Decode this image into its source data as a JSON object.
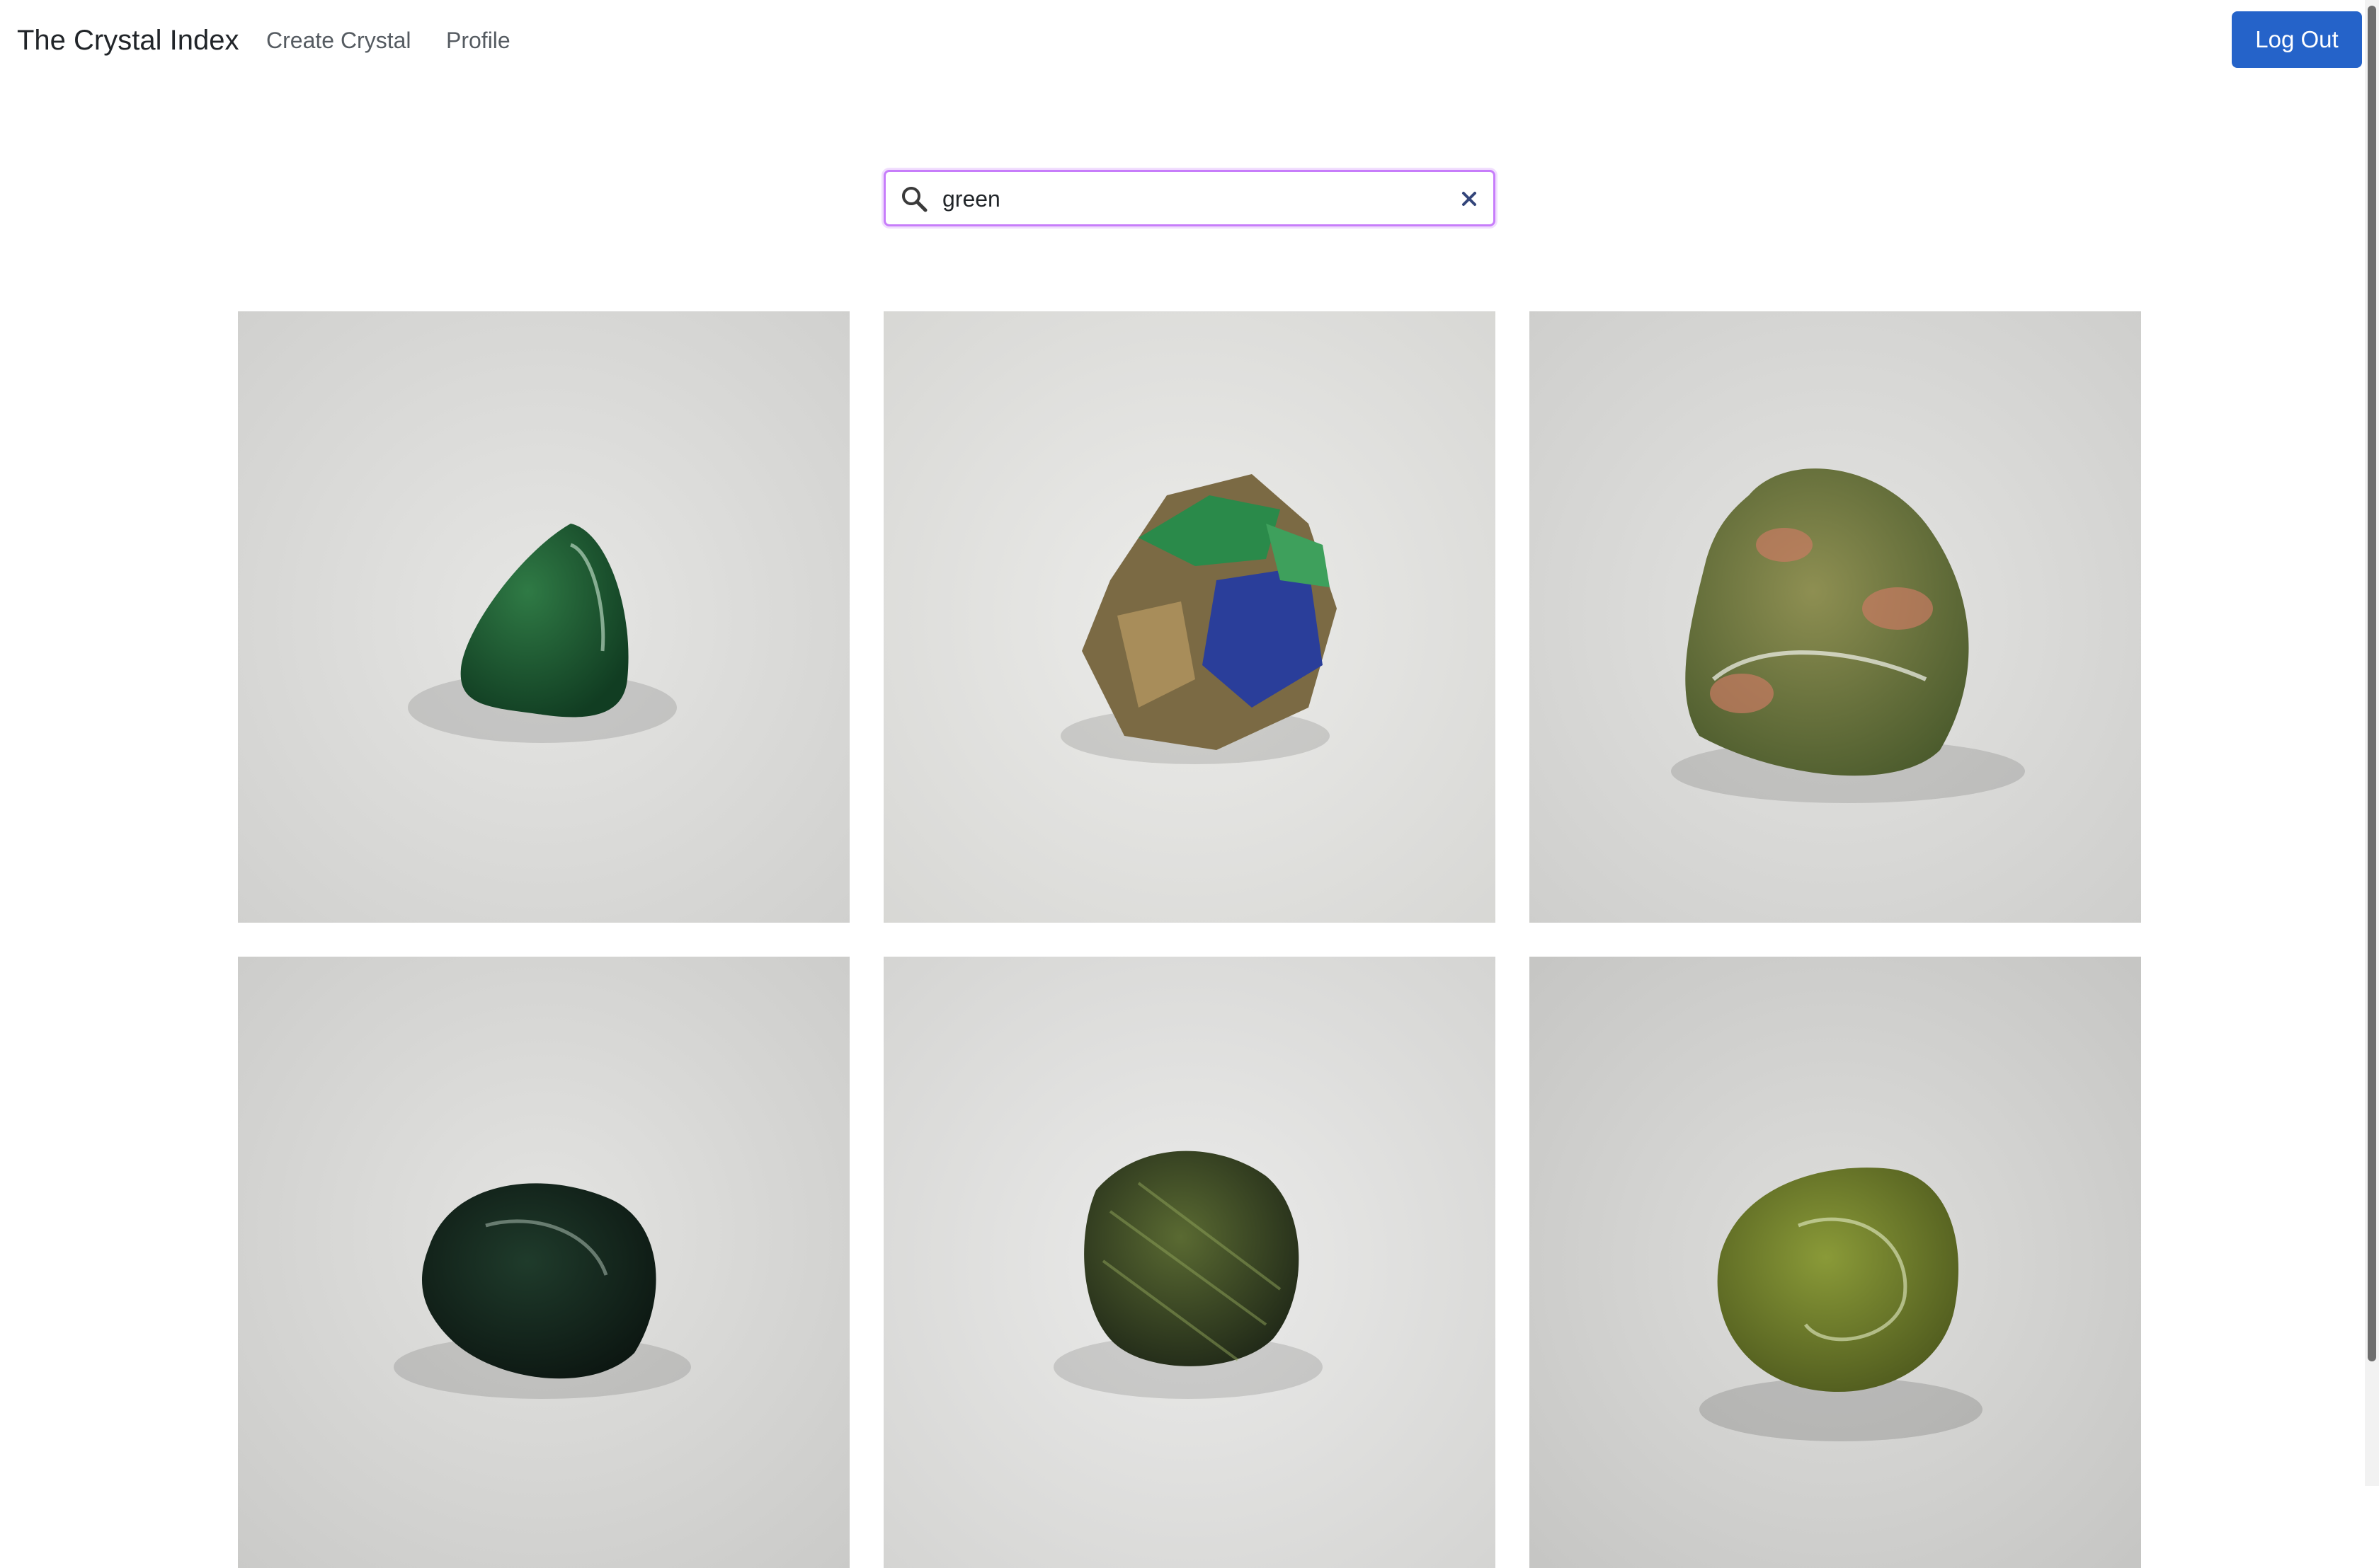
{
  "navbar": {
    "brand": "The Crystal Index",
    "links": [
      {
        "label": "Create Crystal"
      },
      {
        "label": "Profile"
      }
    ],
    "logout_label": "Log Out"
  },
  "search": {
    "value": "green",
    "icons": [
      "search-icon",
      "clear-icon"
    ]
  },
  "crystals": [
    {
      "image": "dark green tumbled stone"
    },
    {
      "image": "green and blue rough mineral"
    },
    {
      "image": "green and pink mottled stone"
    },
    {
      "image": "dark green veined tumbled stone"
    },
    {
      "image": "olive green patterned stone"
    },
    {
      "image": "yellow-green tumbled stone"
    }
  ],
  "colors": {
    "accent": "#2563c9",
    "search_focus": "#c77dfa"
  }
}
